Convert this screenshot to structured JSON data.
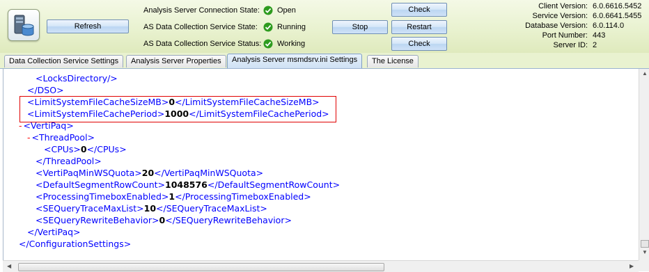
{
  "toolbar": {
    "refresh_label": "Refresh",
    "status_rows": [
      {
        "label": "Analysis Server Connection State:",
        "value": "Open"
      },
      {
        "label": "AS Data Collection Service State:",
        "value": "Running"
      },
      {
        "label": "AS Data Collection Service Status:",
        "value": "Working"
      }
    ],
    "check_label_1": "Check",
    "stop_label": "Stop",
    "restart_label": "Restart",
    "check_label_2": "Check",
    "ok_color": "#2e9b1f"
  },
  "info": [
    {
      "key": "Client Version:",
      "value": "6.0.6616.5452"
    },
    {
      "key": "Service Version:",
      "value": "6.0.6641.5455"
    },
    {
      "key": "Database Version:",
      "value": "6.0.114.0"
    },
    {
      "key": "Port Number:",
      "value": "443"
    },
    {
      "key": "Server ID:",
      "value": "2"
    }
  ],
  "tabs": [
    {
      "label": "Data Collection Service Settings",
      "active": false
    },
    {
      "label": "Analysis Server Properties",
      "active": false
    },
    {
      "label": "Analysis Server msmdsrv.ini Settings",
      "active": true
    },
    {
      "label": "The License",
      "active": false
    }
  ],
  "xml_lines": [
    {
      "open": "<LocksDirectory/>",
      "value": "",
      "close": ""
    },
    {
      "open": "</DSO>",
      "value": "",
      "close": ""
    },
    {
      "open": "<LimitSystemFileCacheSizeMB>",
      "value": "0",
      "close": "</LimitSystemFileCacheSizeMB>"
    },
    {
      "open": "<LimitSystemFileCachePeriod>",
      "value": "1000",
      "close": "</LimitSystemFileCachePeriod>"
    },
    {
      "marker": "-",
      "open": "<VertiPaq>",
      "value": "",
      "close": ""
    },
    {
      "marker": "-",
      "open": "<ThreadPool>",
      "value": "",
      "close": ""
    },
    {
      "open": "<CPUs>",
      "value": "0",
      "close": "</CPUs>"
    },
    {
      "open": "</ThreadPool>",
      "value": "",
      "close": ""
    },
    {
      "open": "<VertiPaqMinWSQuota>",
      "value": "20",
      "close": "</VertiPaqMinWSQuota>"
    },
    {
      "open": "<DefaultSegmentRowCount>",
      "value": "1048576",
      "close": "</DefaultSegmentRowCount>"
    },
    {
      "open": "<ProcessingTimeboxEnabled>",
      "value": "1",
      "close": "</ProcessingTimeboxEnabled>"
    },
    {
      "open": "<SEQueryTraceMaxList>",
      "value": "10",
      "close": "</SEQueryTraceMaxList>"
    },
    {
      "open": "<SEQueryRewriteBehavior>",
      "value": "0",
      "close": "</SEQueryRewriteBehavior>"
    },
    {
      "open": "</VertiPaq>",
      "value": "",
      "close": ""
    },
    {
      "open": "</ConfigurationSettings>",
      "value": "",
      "close": ""
    }
  ]
}
